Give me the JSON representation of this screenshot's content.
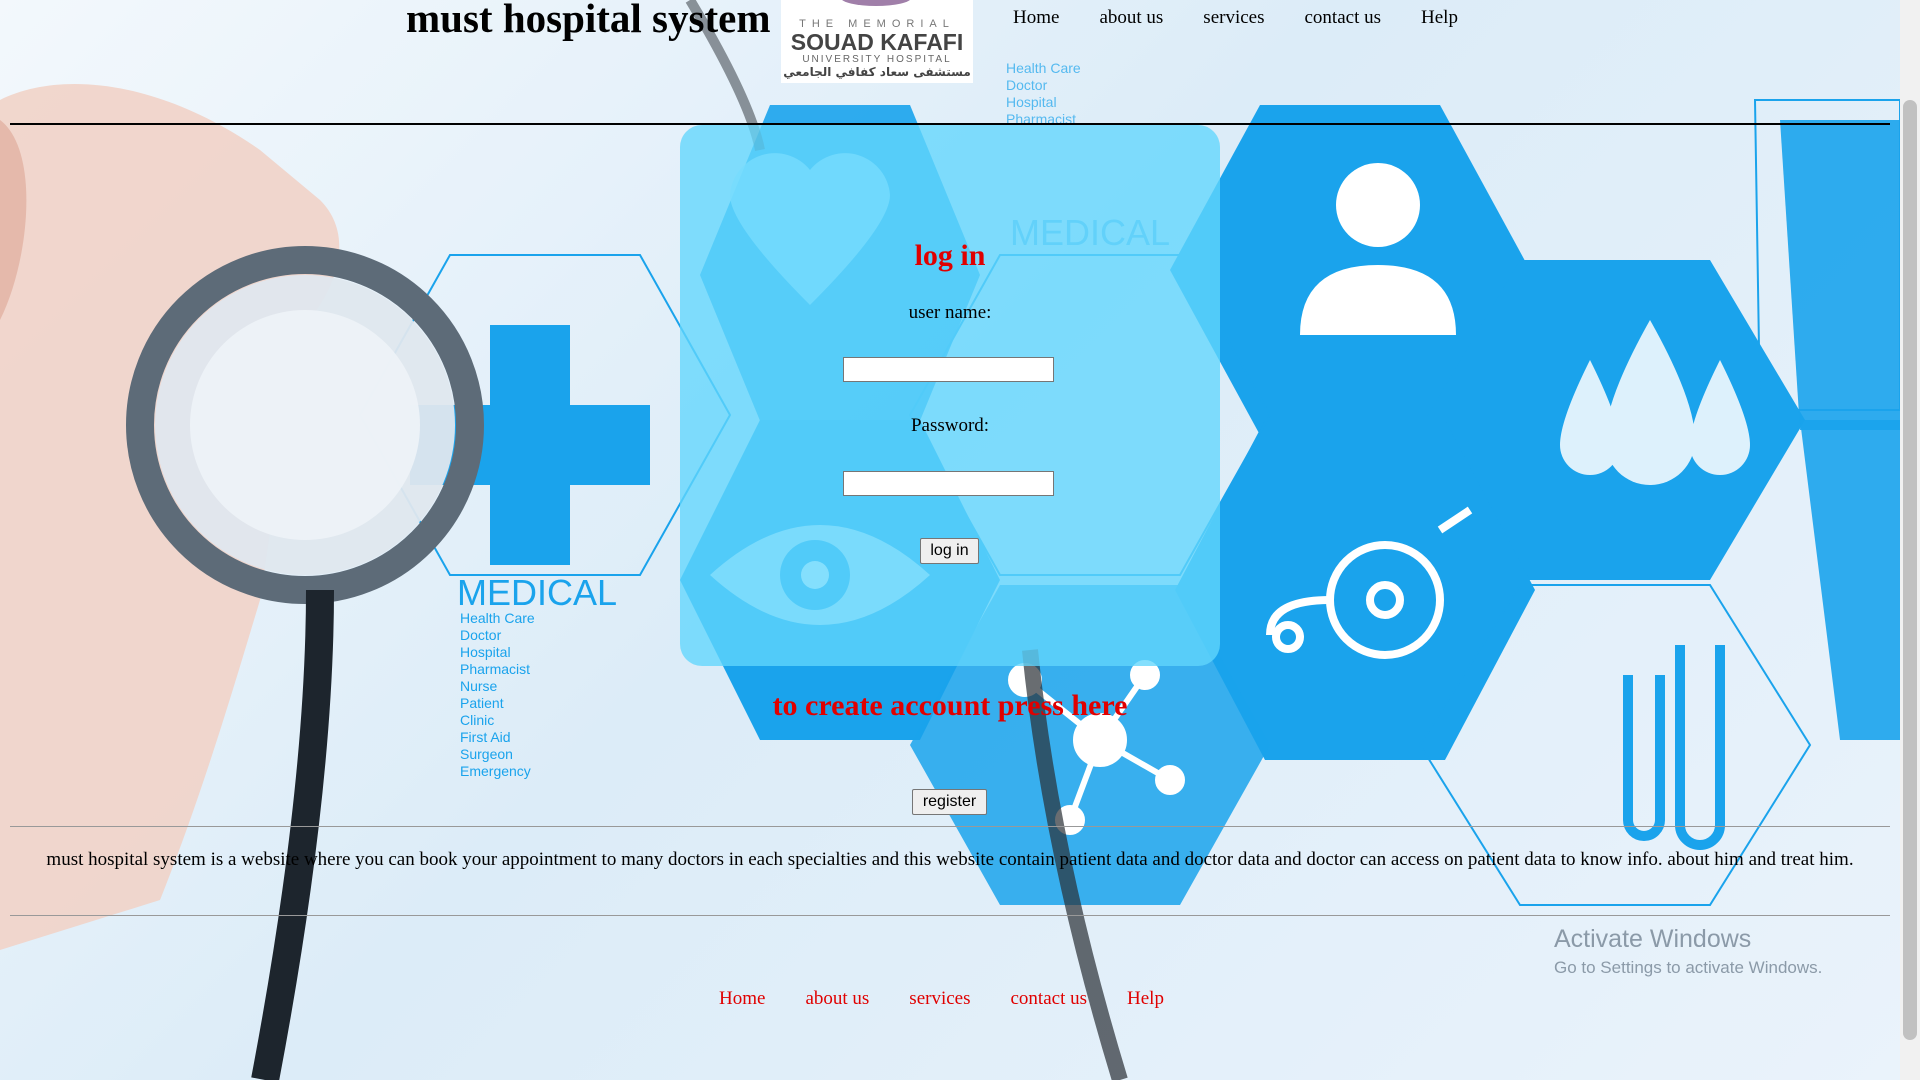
{
  "header": {
    "site_title": "must hospital system",
    "logo": {
      "line1": "THE MEMORIAL",
      "line2": "SOUAD KAFAFI",
      "line3": "UNIVERSITY HOSPITAL",
      "line4": "مستشفى سعاد كفافي الجامعي"
    },
    "nav": [
      "Home",
      "about us",
      "services",
      "contact us",
      "Help"
    ]
  },
  "background": {
    "medical_label": "MEDICAL",
    "medical_list": [
      "Health Care",
      "Doctor",
      "Hospital",
      "Pharmacist",
      "Nurse",
      "Patient",
      "Clinic",
      "First Aid",
      "Surgeon",
      "Emergency"
    ]
  },
  "login": {
    "title": "log in",
    "username_label": "user name:",
    "username_value": "",
    "password_label": "Password:",
    "password_value": "",
    "submit_label": "log in"
  },
  "register": {
    "prompt": "to create account press here",
    "button_label": "register"
  },
  "description": "must hospital system is a website where you can book your appointment to many doctors in each specialties and this website contain patient data and doctor data and doctor can access on patient data to know info. about him and treat him.",
  "footer": {
    "nav": [
      "Home",
      "about us",
      "services",
      "contact us",
      "Help"
    ]
  },
  "watermark": {
    "title": "Activate Windows",
    "subtitle": "Go to Settings to activate Windows."
  },
  "colors": {
    "accent_red": "#e00000",
    "login_panel": "#61d6fc",
    "hex_blue": "#1aa3ec"
  }
}
